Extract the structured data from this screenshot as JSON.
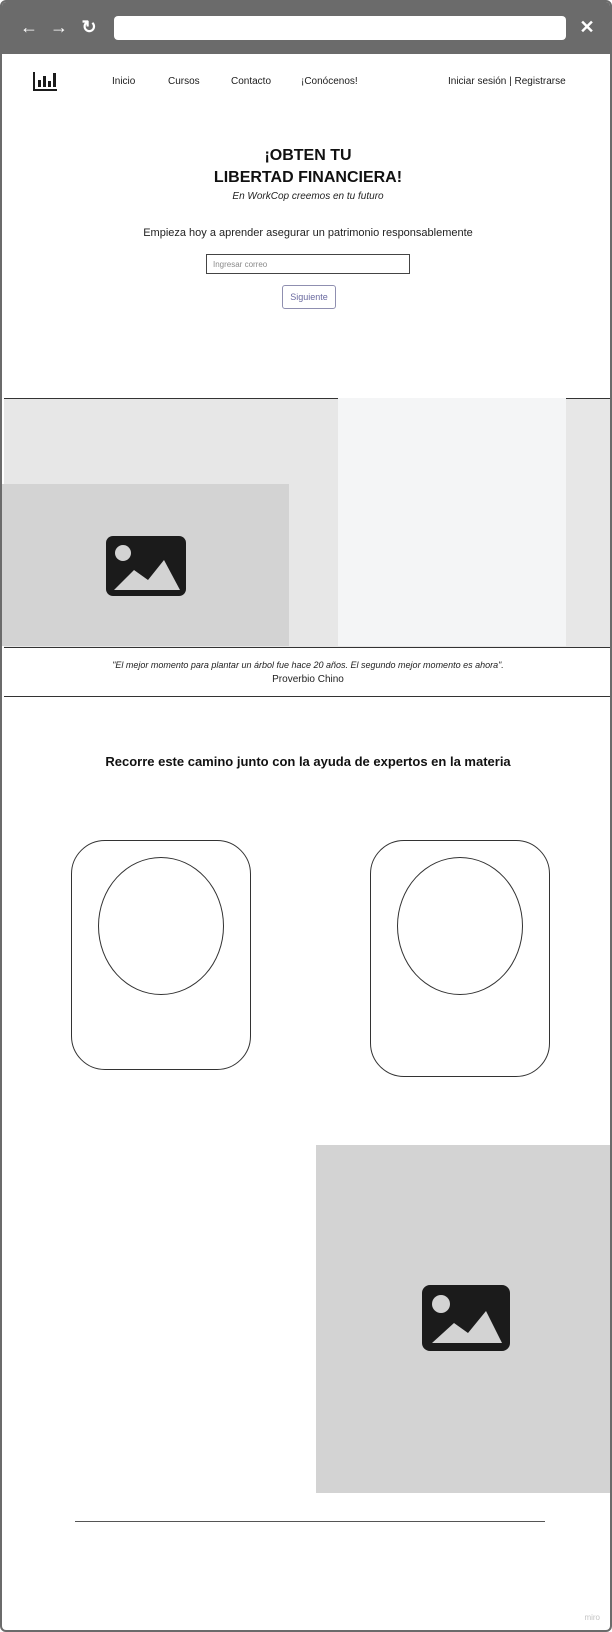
{
  "browser": {
    "back_icon": "arrow-left-icon",
    "forward_icon": "arrow-right-icon",
    "reload_icon": "reload-icon",
    "close_icon": "close-icon",
    "back_glyph": "←",
    "forward_glyph": "→",
    "reload_glyph": "↻",
    "close_glyph": "✕",
    "url": ""
  },
  "header": {
    "logo_icon": "bar-chart-icon",
    "nav": [
      {
        "label": "Inicio"
      },
      {
        "label": "Cursos"
      },
      {
        "label": "Contacto"
      },
      {
        "label": "¡Conócenos!"
      }
    ],
    "auth_label": "Iniciar sesión | Registrarse"
  },
  "hero": {
    "title_line1": "¡OBTEN TU",
    "title_line2": "LIBERTAD FINANCIERA!",
    "subtitle": "En WorkCop creemos en tu futuro",
    "lead": "Empieza hoy a aprender asegurar un patrimonio responsablemente",
    "email_placeholder": "Ingresar correo",
    "next_label": "Siguiente"
  },
  "quote": {
    "text": "\"El mejor momento para plantar un árbol fue hace 20 años. El segundo mejor momento es ahora\".",
    "author": "Proverbio Chino"
  },
  "experts": {
    "title": "Recorre este camino junto con la ayuda de expertos en la materia"
  },
  "images": {
    "placeholder_icon": "image-placeholder-icon"
  },
  "colors": {
    "chrome": "#6b6b6b",
    "band_background": "#e7e7e7",
    "band_panel": "#f4f5f6",
    "image_placeholder": "#d3d3d3",
    "button_text": "#6a6aa0"
  },
  "watermark": "miro"
}
